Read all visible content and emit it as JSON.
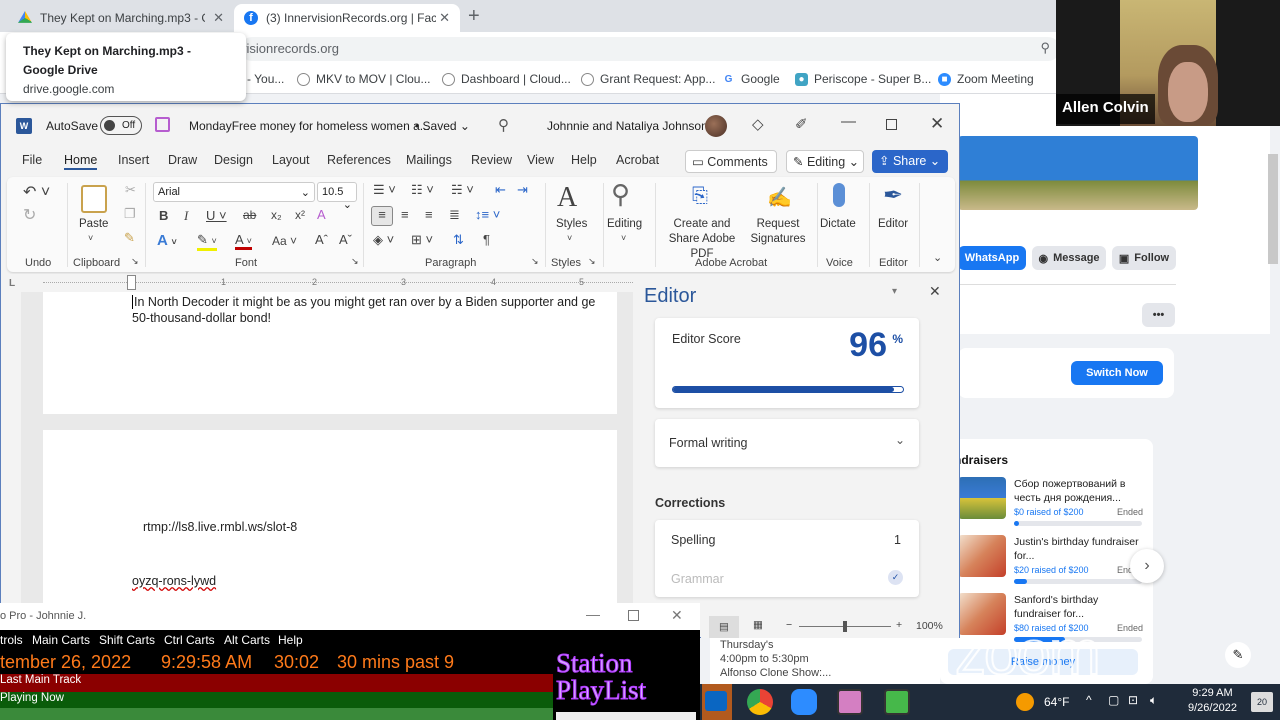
{
  "browser": {
    "tabs": [
      {
        "title": "They Kept on Marching.mp3 - G",
        "icon": "google-drive-icon"
      },
      {
        "title": "(3) InnervisionRecords.org | Face",
        "icon": "facebook-icon"
      }
    ],
    "new_tab": "+",
    "close": "✕",
    "url": "visionrecords.org",
    "tooltip": {
      "title": "They Kept on Marching.mp3 - Google Drive",
      "url": "drive.google.com"
    },
    "bookmarks": [
      {
        "label": "- You...",
        "icon": "youtube-icon"
      },
      {
        "label": "MKV to MOV | Clou...",
        "icon": "cloud-icon"
      },
      {
        "label": "Dashboard | Cloud...",
        "icon": "cloud-icon"
      },
      {
        "label": "Grant Request: App...",
        "icon": "cloud-icon"
      },
      {
        "label": "Google",
        "icon": "google-icon"
      },
      {
        "label": "Periscope - Super B...",
        "icon": "periscope-icon"
      },
      {
        "label": "Zoom Meeting",
        "icon": "zoom-icon"
      }
    ]
  },
  "zoom_video": {
    "participant": "Allen Colvin",
    "watermark": "zoom"
  },
  "word": {
    "autosave_label": "AutoSave",
    "autosave_state": "Off",
    "doc_title": "MondayFree money for homeless women a...",
    "saved": "• Saved ⌄",
    "user": "Johnnie and Nataliya Johnson",
    "menu": [
      "File",
      "Home",
      "Insert",
      "Draw",
      "Design",
      "Layout",
      "References",
      "Mailings",
      "Review",
      "View",
      "Help",
      "Acrobat"
    ],
    "comments": "Comments",
    "editing_mode": "Editing",
    "share": "Share",
    "ribbon": {
      "undo_group": "Undo",
      "clipboard_group": "Clipboard",
      "paste": "Paste",
      "font_name": "Arial",
      "font_size": "10.5",
      "font_group": "Font",
      "paragraph_group": "Paragraph",
      "styles": "Styles",
      "styles_group": "Styles",
      "editing": "Editing",
      "create_pdf": "Create and Share Adobe PDF",
      "request_sig": "Request Signatures",
      "acrobat_group": "Adobe Acrobat",
      "dictate": "Dictate",
      "voice_group": "Voice",
      "editor": "Editor",
      "editor_group": "Editor",
      "case_btn": "Aa"
    },
    "ruler_marks": [
      "1",
      "2",
      "3",
      "4",
      "5"
    ],
    "document": {
      "line1": "In North Decoder it might be as you might get ran over by a Biden supporter and ge",
      "line2": "50-thousand-dollar bond!",
      "line3": "rtmp://ls8.live.rmbl.ws/slot-8",
      "line4": "oyzq-rons-lywd"
    },
    "editor_pane": {
      "title": "Editor",
      "score_label": "Editor Score",
      "score": "96",
      "score_pct": 96,
      "percent": "%",
      "mode": "Formal writing",
      "corrections_title": "Corrections",
      "spelling_label": "Spelling",
      "spelling_count": "1",
      "grammar_label": "Grammar"
    },
    "zoom_level": "100%",
    "zoom_fraction": 0.5
  },
  "facebook": {
    "whatsapp": "WhatsApp",
    "message": "Message",
    "follow": "Follow",
    "more": "•••",
    "switch_now": "Switch Now",
    "fundraisers_title": "ndraisers",
    "fundraisers": [
      {
        "title": "Сбор пожертвований в честь дня рождения...",
        "raised": "$0 raised of $200",
        "status": "Ended",
        "progress": 0.0
      },
      {
        "title": "Justin's birthday fundraiser for...",
        "raised": "$20 raised of $200",
        "status": "End",
        "progress": 0.1
      },
      {
        "title": "Sanford's birthday fundraiser for...",
        "raised": "$80 raised of $200",
        "status": "Ended",
        "progress": 0.4
      }
    ],
    "raise_money": "Raise money"
  },
  "schedule": {
    "line1": "Thursday's",
    "line2": "4:00pm to 5:30pm",
    "line3": "Alfonso Clone Show:..."
  },
  "playlist": {
    "title": "o Pro - Johnnie J.",
    "menu": [
      "trols",
      "Main Carts",
      "Shift Carts",
      "Ctrl Carts",
      "Alt Carts",
      "Help"
    ],
    "date": "tember 26, 2022",
    "time": "9:29:58 AM",
    "elapsed": "30:02",
    "past": "30 mins past 9",
    "last_track": "Last Main Track",
    "playing_now": "Playing Now",
    "logo_line1": "Station",
    "logo_line2": "PlayList"
  },
  "taskbar": {
    "weather": "64°F",
    "time": "9:29 AM",
    "date": "9/26/2022",
    "notifications": "20"
  }
}
